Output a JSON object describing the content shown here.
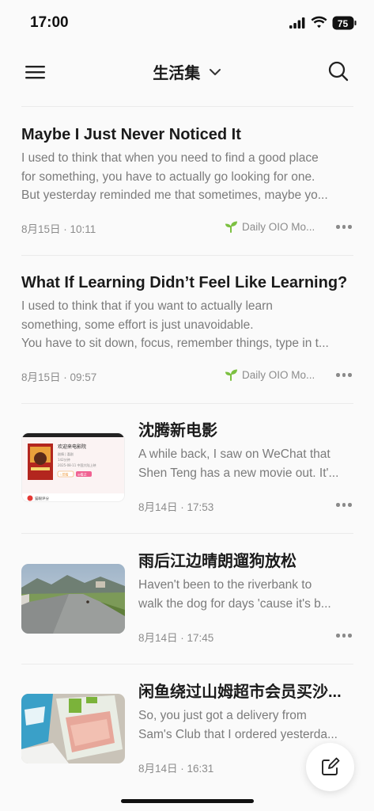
{
  "status_bar": {
    "time": "17:00",
    "battery": "75"
  },
  "nav": {
    "title": "生活集"
  },
  "posts": [
    {
      "title": "Maybe I Just Never Noticed It",
      "excerpt": [
        "I used to think that when you need to find a good place",
        "for something, you have to actually go looking for one.",
        "But yesterday reminded me that sometimes, maybe yo..."
      ],
      "date": "8月15日 · 10:11",
      "source": "Daily OIO Mo..."
    },
    {
      "title": "What If Learning Didn’t Feel Like Learning?",
      "excerpt": [
        "I used to think that if you want to actually learn",
        "something, some effort is just unavoidable.",
        "You have to sit down, focus, remember things, type in t..."
      ],
      "date": "8月15日 · 09:57",
      "source": "Daily OIO Mo..."
    }
  ],
  "image_posts": [
    {
      "title": "沈腾新电影",
      "excerpt": [
        "A while back, I saw on WeChat that",
        "Shen Teng has a new movie out. It'..."
      ],
      "date": "8月14日 · 17:53",
      "thumb_text": {
        "line1": "欢迎来电影院",
        "line2": "剧情 | 喜剧",
        "line3": "142分钟",
        "line4": "2025-08-11 中国大陆上映",
        "btn1": "☆想看",
        "btn2": "◎看过",
        "footer": "猫眼评分"
      }
    },
    {
      "title": "雨后江边晴朗遛狗放松",
      "excerpt": [
        "Haven't been to the riverbank to",
        "walk the dog for days 'cause it's b..."
      ],
      "date": "8月14日 · 17:45"
    },
    {
      "title": "闲鱼绕过山姆超市会员买沙...",
      "excerpt": [
        "So, you just got a delivery from",
        "Sam's Club that I ordered yesterda..."
      ],
      "date": "8月14日 · 16:31"
    }
  ],
  "icons": {
    "menu": "menu-icon",
    "dropdown": "chevron-down-icon",
    "search": "search-icon",
    "source": "sprout-icon",
    "more": "more-icon",
    "compose": "compose-icon"
  },
  "colors": {
    "accent_green": "#7cc041",
    "background": "#fafafa"
  }
}
